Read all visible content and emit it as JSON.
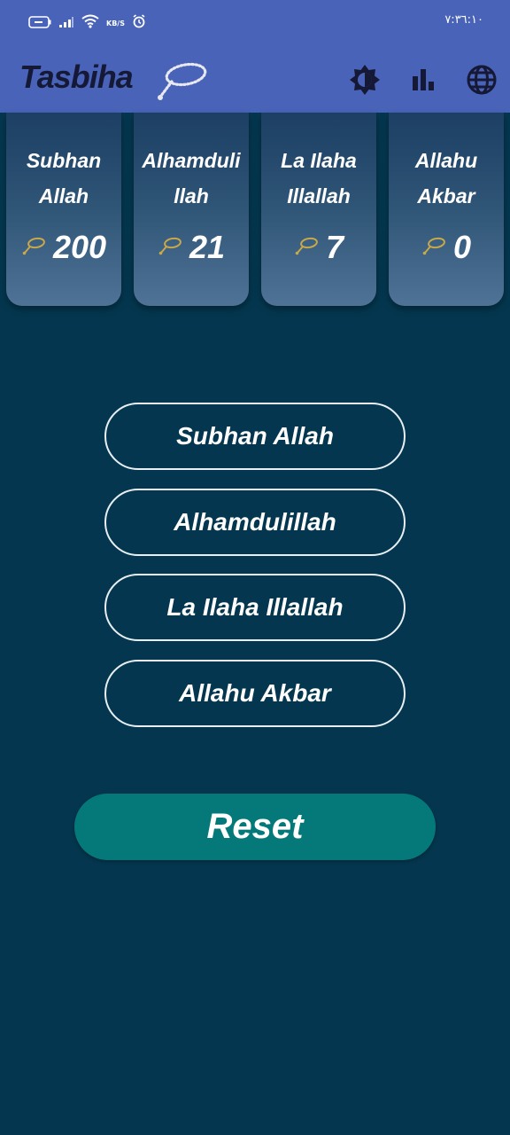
{
  "status_bar": {
    "time": "٧:٣٦:١٠",
    "speed_unit": "KB/S",
    "icons": [
      "battery-icon",
      "signal-icon",
      "wifi-icon",
      "alarm-icon"
    ]
  },
  "app_bar": {
    "title": "Tasbiha",
    "title_icon": "prayer-beads-icon",
    "actions": [
      "theme-icon",
      "stats-icon",
      "language-icon"
    ]
  },
  "cards": [
    {
      "label": "Subhan\nAllah",
      "count": "200"
    },
    {
      "label": "Alhamduli\nllah",
      "count": "21"
    },
    {
      "label": "La Ilaha\nIllallah",
      "count": "7"
    },
    {
      "label": "Allahu\nAkbar",
      "count": "0"
    }
  ],
  "buttons": [
    {
      "label": "Subhan Allah"
    },
    {
      "label": "Alhamdulillah"
    },
    {
      "label": "La Ilaha Illallah"
    },
    {
      "label": "Allahu Akbar"
    }
  ],
  "reset_label": "Reset",
  "colors": {
    "app_bar": "#4863b8",
    "background": "#04374f",
    "reset": "#05797a",
    "beads_icon": "#c9a84a"
  }
}
